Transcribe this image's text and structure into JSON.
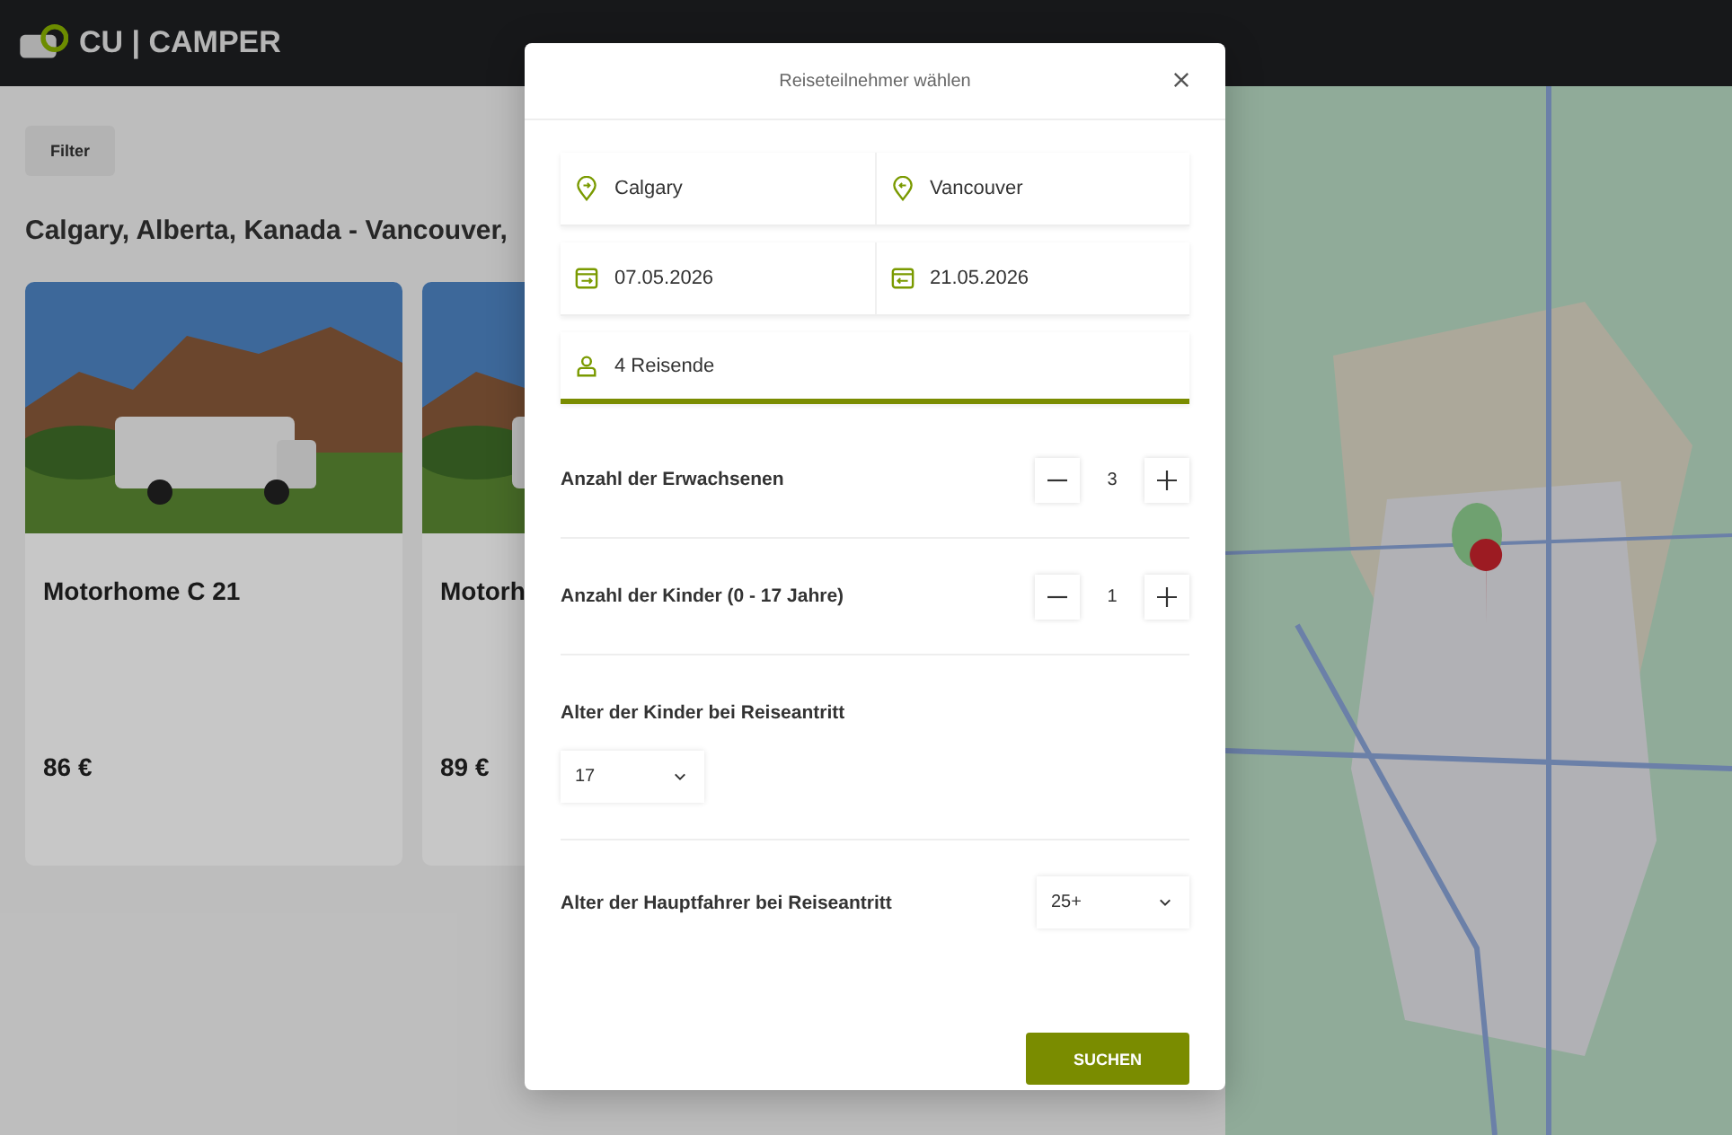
{
  "header": {
    "logo": "CU | CAMPER"
  },
  "background": {
    "filter_button": "Filter",
    "heading": "Calgary, Alberta, Kanada - Vancouver,",
    "cards": [
      {
        "title": "Motorhome C 21",
        "price": "86 €"
      },
      {
        "title": "Motorh",
        "price": "89 €"
      }
    ]
  },
  "dialog": {
    "title": "Reiseteilnehmer wählen",
    "locations": [
      {
        "kind": "pickup",
        "value": "Calgary"
      },
      {
        "kind": "return",
        "value": "Vancouver"
      }
    ],
    "dates": [
      {
        "kind": "pickup",
        "value": "07.05.2026"
      },
      {
        "kind": "return",
        "value": "21.05.2026"
      }
    ],
    "travelers": {
      "value": "4 Reisende",
      "active": true
    },
    "steppers": [
      {
        "label": "Anzahl der Erwachsenen",
        "value": "3"
      },
      {
        "label": "Anzahl der Kinder (0 - 17 Jahre)",
        "value": "1"
      }
    ],
    "child_ages": {
      "label": "Alter der Kinder bei Reiseantritt",
      "selects": [
        "17"
      ]
    },
    "driver_age": {
      "label": "Alter der Hauptfahrer bei Reiseantritt",
      "value": "25+"
    },
    "submit": "SUCHEN"
  }
}
